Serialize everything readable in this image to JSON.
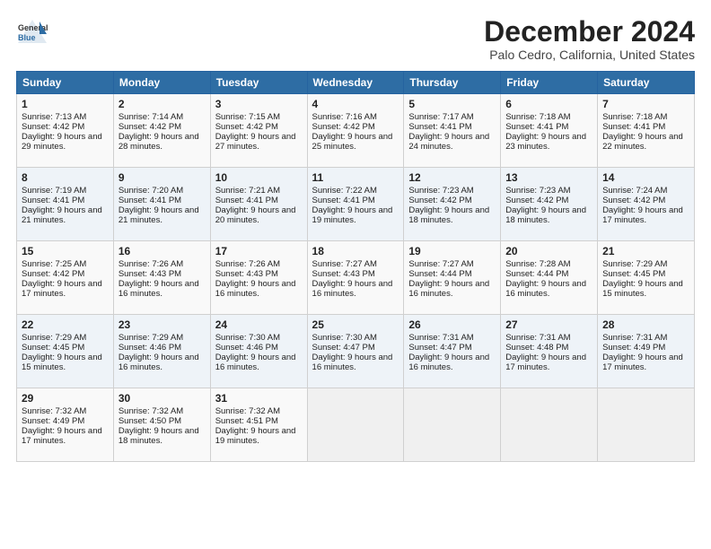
{
  "header": {
    "logo_general": "General",
    "logo_blue": "Blue",
    "title": "December 2024",
    "location": "Palo Cedro, California, United States"
  },
  "days_of_week": [
    "Sunday",
    "Monday",
    "Tuesday",
    "Wednesday",
    "Thursday",
    "Friday",
    "Saturday"
  ],
  "weeks": [
    [
      {
        "day": "1",
        "sunrise": "Sunrise: 7:13 AM",
        "sunset": "Sunset: 4:42 PM",
        "daylight": "Daylight: 9 hours and 29 minutes."
      },
      {
        "day": "2",
        "sunrise": "Sunrise: 7:14 AM",
        "sunset": "Sunset: 4:42 PM",
        "daylight": "Daylight: 9 hours and 28 minutes."
      },
      {
        "day": "3",
        "sunrise": "Sunrise: 7:15 AM",
        "sunset": "Sunset: 4:42 PM",
        "daylight": "Daylight: 9 hours and 27 minutes."
      },
      {
        "day": "4",
        "sunrise": "Sunrise: 7:16 AM",
        "sunset": "Sunset: 4:42 PM",
        "daylight": "Daylight: 9 hours and 25 minutes."
      },
      {
        "day": "5",
        "sunrise": "Sunrise: 7:17 AM",
        "sunset": "Sunset: 4:41 PM",
        "daylight": "Daylight: 9 hours and 24 minutes."
      },
      {
        "day": "6",
        "sunrise": "Sunrise: 7:18 AM",
        "sunset": "Sunset: 4:41 PM",
        "daylight": "Daylight: 9 hours and 23 minutes."
      },
      {
        "day": "7",
        "sunrise": "Sunrise: 7:18 AM",
        "sunset": "Sunset: 4:41 PM",
        "daylight": "Daylight: 9 hours and 22 minutes."
      }
    ],
    [
      {
        "day": "8",
        "sunrise": "Sunrise: 7:19 AM",
        "sunset": "Sunset: 4:41 PM",
        "daylight": "Daylight: 9 hours and 21 minutes."
      },
      {
        "day": "9",
        "sunrise": "Sunrise: 7:20 AM",
        "sunset": "Sunset: 4:41 PM",
        "daylight": "Daylight: 9 hours and 21 minutes."
      },
      {
        "day": "10",
        "sunrise": "Sunrise: 7:21 AM",
        "sunset": "Sunset: 4:41 PM",
        "daylight": "Daylight: 9 hours and 20 minutes."
      },
      {
        "day": "11",
        "sunrise": "Sunrise: 7:22 AM",
        "sunset": "Sunset: 4:41 PM",
        "daylight": "Daylight: 9 hours and 19 minutes."
      },
      {
        "day": "12",
        "sunrise": "Sunrise: 7:23 AM",
        "sunset": "Sunset: 4:42 PM",
        "daylight": "Daylight: 9 hours and 18 minutes."
      },
      {
        "day": "13",
        "sunrise": "Sunrise: 7:23 AM",
        "sunset": "Sunset: 4:42 PM",
        "daylight": "Daylight: 9 hours and 18 minutes."
      },
      {
        "day": "14",
        "sunrise": "Sunrise: 7:24 AM",
        "sunset": "Sunset: 4:42 PM",
        "daylight": "Daylight: 9 hours and 17 minutes."
      }
    ],
    [
      {
        "day": "15",
        "sunrise": "Sunrise: 7:25 AM",
        "sunset": "Sunset: 4:42 PM",
        "daylight": "Daylight: 9 hours and 17 minutes."
      },
      {
        "day": "16",
        "sunrise": "Sunrise: 7:26 AM",
        "sunset": "Sunset: 4:43 PM",
        "daylight": "Daylight: 9 hours and 16 minutes."
      },
      {
        "day": "17",
        "sunrise": "Sunrise: 7:26 AM",
        "sunset": "Sunset: 4:43 PM",
        "daylight": "Daylight: 9 hours and 16 minutes."
      },
      {
        "day": "18",
        "sunrise": "Sunrise: 7:27 AM",
        "sunset": "Sunset: 4:43 PM",
        "daylight": "Daylight: 9 hours and 16 minutes."
      },
      {
        "day": "19",
        "sunrise": "Sunrise: 7:27 AM",
        "sunset": "Sunset: 4:44 PM",
        "daylight": "Daylight: 9 hours and 16 minutes."
      },
      {
        "day": "20",
        "sunrise": "Sunrise: 7:28 AM",
        "sunset": "Sunset: 4:44 PM",
        "daylight": "Daylight: 9 hours and 16 minutes."
      },
      {
        "day": "21",
        "sunrise": "Sunrise: 7:29 AM",
        "sunset": "Sunset: 4:45 PM",
        "daylight": "Daylight: 9 hours and 15 minutes."
      }
    ],
    [
      {
        "day": "22",
        "sunrise": "Sunrise: 7:29 AM",
        "sunset": "Sunset: 4:45 PM",
        "daylight": "Daylight: 9 hours and 15 minutes."
      },
      {
        "day": "23",
        "sunrise": "Sunrise: 7:29 AM",
        "sunset": "Sunset: 4:46 PM",
        "daylight": "Daylight: 9 hours and 16 minutes."
      },
      {
        "day": "24",
        "sunrise": "Sunrise: 7:30 AM",
        "sunset": "Sunset: 4:46 PM",
        "daylight": "Daylight: 9 hours and 16 minutes."
      },
      {
        "day": "25",
        "sunrise": "Sunrise: 7:30 AM",
        "sunset": "Sunset: 4:47 PM",
        "daylight": "Daylight: 9 hours and 16 minutes."
      },
      {
        "day": "26",
        "sunrise": "Sunrise: 7:31 AM",
        "sunset": "Sunset: 4:47 PM",
        "daylight": "Daylight: 9 hours and 16 minutes."
      },
      {
        "day": "27",
        "sunrise": "Sunrise: 7:31 AM",
        "sunset": "Sunset: 4:48 PM",
        "daylight": "Daylight: 9 hours and 17 minutes."
      },
      {
        "day": "28",
        "sunrise": "Sunrise: 7:31 AM",
        "sunset": "Sunset: 4:49 PM",
        "daylight": "Daylight: 9 hours and 17 minutes."
      }
    ],
    [
      {
        "day": "29",
        "sunrise": "Sunrise: 7:32 AM",
        "sunset": "Sunset: 4:49 PM",
        "daylight": "Daylight: 9 hours and 17 minutes."
      },
      {
        "day": "30",
        "sunrise": "Sunrise: 7:32 AM",
        "sunset": "Sunset: 4:50 PM",
        "daylight": "Daylight: 9 hours and 18 minutes."
      },
      {
        "day": "31",
        "sunrise": "Sunrise: 7:32 AM",
        "sunset": "Sunset: 4:51 PM",
        "daylight": "Daylight: 9 hours and 19 minutes."
      },
      null,
      null,
      null,
      null
    ]
  ]
}
